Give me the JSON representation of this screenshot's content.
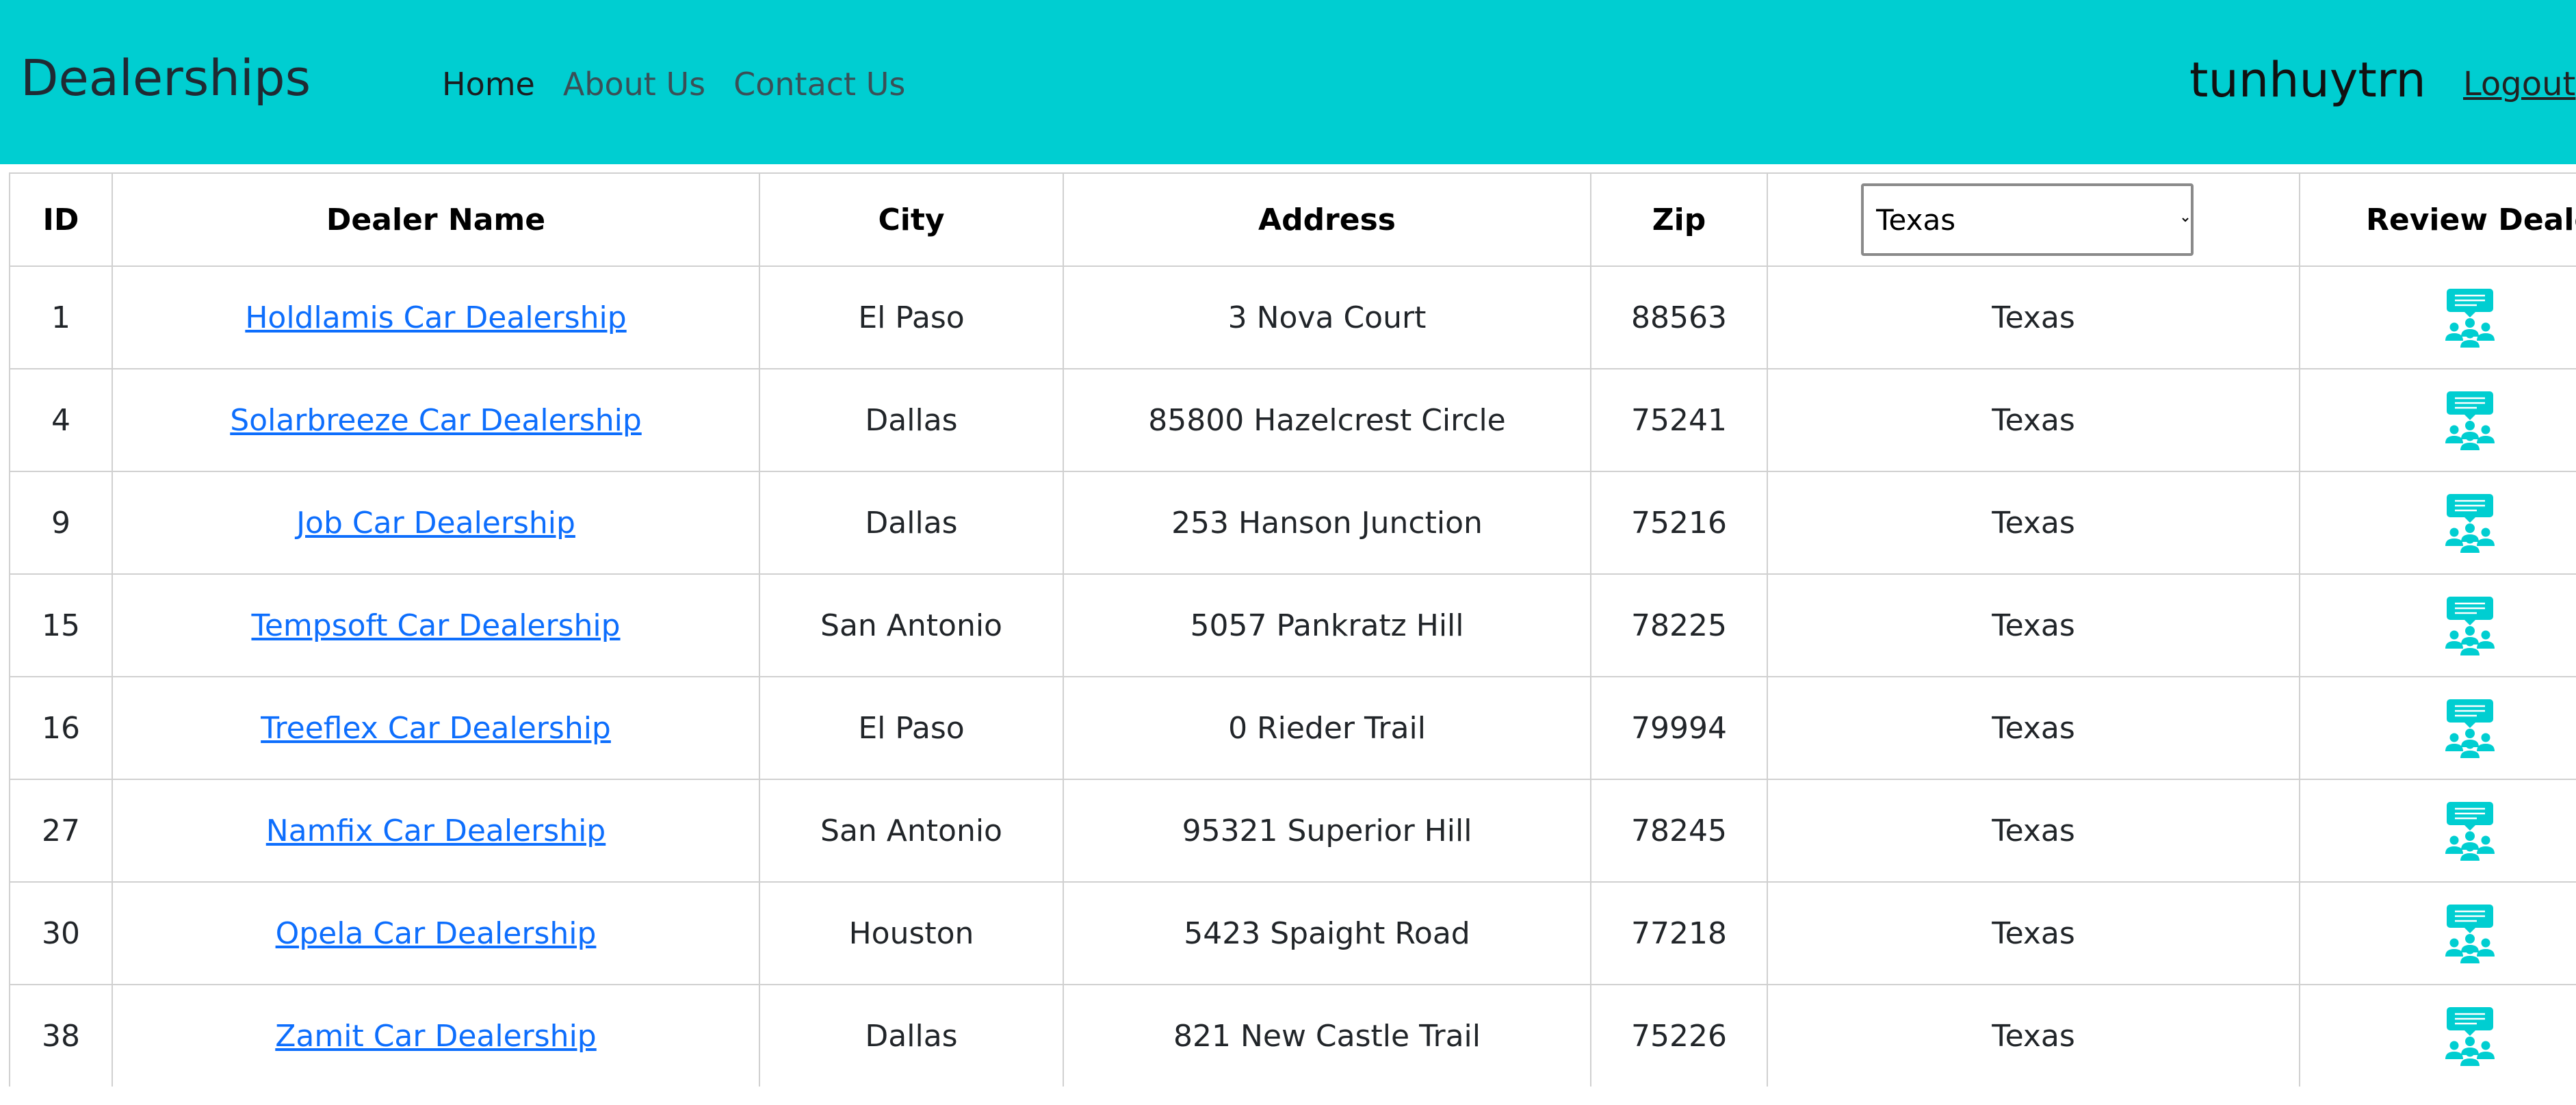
{
  "navbar": {
    "brand": "Dealerships",
    "links": [
      {
        "label": "Home"
      },
      {
        "label": "About Us"
      },
      {
        "label": "Contact Us"
      }
    ],
    "username": "tunhuytrn",
    "logout_label": "Logout"
  },
  "table": {
    "headers": {
      "id": "ID",
      "dealer_name": "Dealer Name",
      "city": "City",
      "address": "Address",
      "zip": "Zip",
      "review": "Review Dealer"
    },
    "state_filter": {
      "selected": "Texas"
    },
    "review_icon": "review-dealer-icon",
    "accent_color": "#00ced1",
    "rows": [
      {
        "id": "1",
        "name": "Holdlamis Car Dealership",
        "city": "El Paso",
        "address": "3 Nova Court",
        "zip": "88563",
        "state": "Texas"
      },
      {
        "id": "4",
        "name": "Solarbreeze Car Dealership",
        "city": "Dallas",
        "address": "85800 Hazelcrest Circle",
        "zip": "75241",
        "state": "Texas"
      },
      {
        "id": "9",
        "name": "Job Car Dealership",
        "city": "Dallas",
        "address": "253 Hanson Junction",
        "zip": "75216",
        "state": "Texas"
      },
      {
        "id": "15",
        "name": "Tempsoft Car Dealership",
        "city": "San Antonio",
        "address": "5057 Pankratz Hill",
        "zip": "78225",
        "state": "Texas"
      },
      {
        "id": "16",
        "name": "Treeflex Car Dealership",
        "city": "El Paso",
        "address": "0 Rieder Trail",
        "zip": "79994",
        "state": "Texas"
      },
      {
        "id": "27",
        "name": "Namfix Car Dealership",
        "city": "San Antonio",
        "address": "95321 Superior Hill",
        "zip": "78245",
        "state": "Texas"
      },
      {
        "id": "30",
        "name": "Opela Car Dealership",
        "city": "Houston",
        "address": "5423 Spaight Road",
        "zip": "77218",
        "state": "Texas"
      },
      {
        "id": "38",
        "name": "Zamit Car Dealership",
        "city": "Dallas",
        "address": "821 New Castle Trail",
        "zip": "75226",
        "state": "Texas"
      }
    ]
  }
}
